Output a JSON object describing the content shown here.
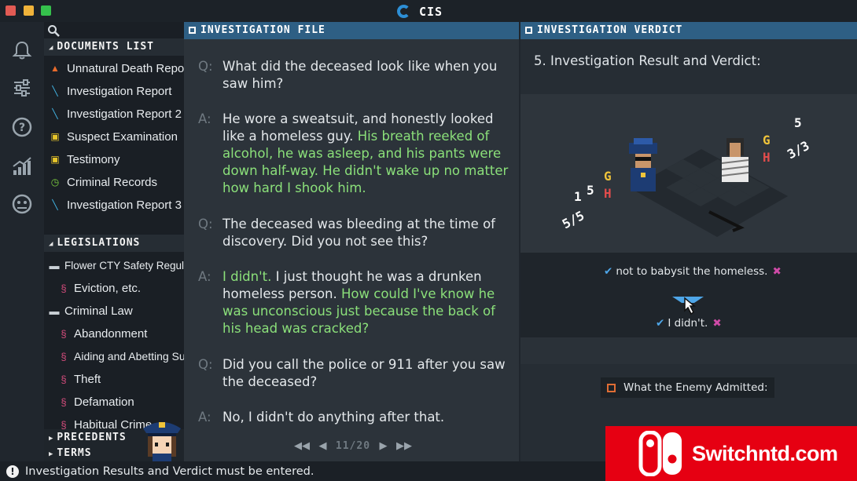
{
  "window": {
    "title": "CIS"
  },
  "nav": {
    "icons": [
      "bell-icon",
      "sliders-icon",
      "help-icon",
      "stats-icon",
      "settings-face-icon"
    ]
  },
  "documents": {
    "header": "DOCUMENTS LIST",
    "items": [
      {
        "label": "Unnatural Death Report",
        "icon": "cone-icon",
        "color": "#e86b2c"
      },
      {
        "label": "Investigation Report",
        "icon": "pen-icon",
        "color": "#42b6e6"
      },
      {
        "label": "Investigation Report 2",
        "icon": "pen-icon",
        "color": "#42b6e6"
      },
      {
        "label": "Suspect Examination",
        "icon": "badge-icon",
        "color": "#e7c52a"
      },
      {
        "label": "Testimony",
        "icon": "badge-icon",
        "color": "#e7c52a"
      },
      {
        "label": "Criminal Records",
        "icon": "clock-icon",
        "color": "#7fd33f"
      },
      {
        "label": "Investigation Report 3",
        "icon": "pen-icon",
        "color": "#42b6e6"
      }
    ]
  },
  "legislations": {
    "header": "LEGISLATIONS",
    "items": [
      {
        "label": "Flower CTY Safety Regulations",
        "type": "folder"
      },
      {
        "label": "Eviction, etc.",
        "type": "law"
      },
      {
        "label": "Criminal Law",
        "type": "folder"
      },
      {
        "label": "Abandonment",
        "type": "law"
      },
      {
        "label": "Aiding and Abetting Suicide",
        "type": "law"
      },
      {
        "label": "Theft",
        "type": "law"
      },
      {
        "label": "Defamation",
        "type": "law"
      },
      {
        "label": "Habitual Crime",
        "type": "law"
      }
    ]
  },
  "precedents": {
    "header": "PRECEDENTS"
  },
  "terms": {
    "header": "TERMS"
  },
  "file": {
    "header": "INVESTIGATION FILE",
    "entries": [
      {
        "label": "Q:",
        "text": "What did the deceased look like when you saw him?"
      },
      {
        "label": "A:",
        "text": "He wore a sweatsuit, and honestly looked like a homeless guy.",
        "highlight": "His breath reeked of alcohol, he was asleep, and his pants were down half-way. He didn't wake up no matter how hard I shook him."
      },
      {
        "label": "Q:",
        "text": "The deceased was bleeding at the time of discovery. Did you not see this?"
      },
      {
        "label": "A:",
        "highlight": "I didn't.",
        "text": "I just thought he was a drunken homeless person.",
        "highlight2": "How could I've know he was unconscious just because the back of his head was cracked?"
      },
      {
        "label": "Q:",
        "text": "Did you call the police or 911 after you saw the deceased?"
      },
      {
        "label": "A:",
        "highlight": "No, I didn't do anything after that."
      }
    ],
    "pager": "11/20"
  },
  "verdict": {
    "header": "INVESTIGATION VERDICT",
    "title": "5. Investigation Result and Verdict:",
    "scene": {
      "left_stats": [
        "1",
        "5",
        "G",
        "H",
        "5/5"
      ],
      "right_stats": [
        "5",
        "G",
        "3/3",
        "H"
      ]
    },
    "option1": "not to babysit the homeless.",
    "option2": "I didn't.",
    "enemy_label": "What the Enemy Admitted:"
  },
  "status": {
    "text": "Investigation Results and Verdict must be entered."
  },
  "watermark": {
    "text": "Switchntd.com"
  },
  "colors": {
    "accent_blue": "#2e5f84",
    "highlight_green": "#8be07a",
    "check_blue": "#4ea6e8",
    "cross_pink": "#d04ba8",
    "watermark_red": "#e60012"
  }
}
